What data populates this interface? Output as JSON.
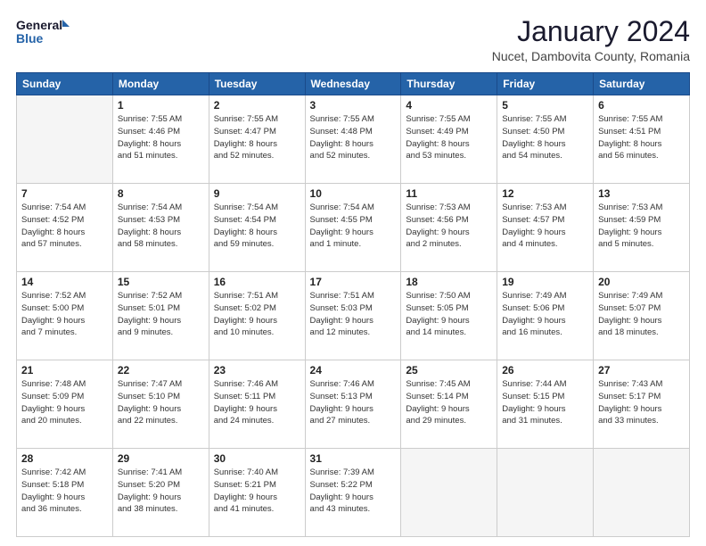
{
  "header": {
    "logo_line1": "General",
    "logo_line2": "Blue",
    "month": "January 2024",
    "location": "Nucet, Dambovita County, Romania"
  },
  "weekdays": [
    "Sunday",
    "Monday",
    "Tuesday",
    "Wednesday",
    "Thursday",
    "Friday",
    "Saturday"
  ],
  "weeks": [
    [
      {
        "day": "",
        "info": ""
      },
      {
        "day": "1",
        "info": "Sunrise: 7:55 AM\nSunset: 4:46 PM\nDaylight: 8 hours\nand 51 minutes."
      },
      {
        "day": "2",
        "info": "Sunrise: 7:55 AM\nSunset: 4:47 PM\nDaylight: 8 hours\nand 52 minutes."
      },
      {
        "day": "3",
        "info": "Sunrise: 7:55 AM\nSunset: 4:48 PM\nDaylight: 8 hours\nand 52 minutes."
      },
      {
        "day": "4",
        "info": "Sunrise: 7:55 AM\nSunset: 4:49 PM\nDaylight: 8 hours\nand 53 minutes."
      },
      {
        "day": "5",
        "info": "Sunrise: 7:55 AM\nSunset: 4:50 PM\nDaylight: 8 hours\nand 54 minutes."
      },
      {
        "day": "6",
        "info": "Sunrise: 7:55 AM\nSunset: 4:51 PM\nDaylight: 8 hours\nand 56 minutes."
      }
    ],
    [
      {
        "day": "7",
        "info": "Sunrise: 7:54 AM\nSunset: 4:52 PM\nDaylight: 8 hours\nand 57 minutes."
      },
      {
        "day": "8",
        "info": "Sunrise: 7:54 AM\nSunset: 4:53 PM\nDaylight: 8 hours\nand 58 minutes."
      },
      {
        "day": "9",
        "info": "Sunrise: 7:54 AM\nSunset: 4:54 PM\nDaylight: 8 hours\nand 59 minutes."
      },
      {
        "day": "10",
        "info": "Sunrise: 7:54 AM\nSunset: 4:55 PM\nDaylight: 9 hours\nand 1 minute."
      },
      {
        "day": "11",
        "info": "Sunrise: 7:53 AM\nSunset: 4:56 PM\nDaylight: 9 hours\nand 2 minutes."
      },
      {
        "day": "12",
        "info": "Sunrise: 7:53 AM\nSunset: 4:57 PM\nDaylight: 9 hours\nand 4 minutes."
      },
      {
        "day": "13",
        "info": "Sunrise: 7:53 AM\nSunset: 4:59 PM\nDaylight: 9 hours\nand 5 minutes."
      }
    ],
    [
      {
        "day": "14",
        "info": "Sunrise: 7:52 AM\nSunset: 5:00 PM\nDaylight: 9 hours\nand 7 minutes."
      },
      {
        "day": "15",
        "info": "Sunrise: 7:52 AM\nSunset: 5:01 PM\nDaylight: 9 hours\nand 9 minutes."
      },
      {
        "day": "16",
        "info": "Sunrise: 7:51 AM\nSunset: 5:02 PM\nDaylight: 9 hours\nand 10 minutes."
      },
      {
        "day": "17",
        "info": "Sunrise: 7:51 AM\nSunset: 5:03 PM\nDaylight: 9 hours\nand 12 minutes."
      },
      {
        "day": "18",
        "info": "Sunrise: 7:50 AM\nSunset: 5:05 PM\nDaylight: 9 hours\nand 14 minutes."
      },
      {
        "day": "19",
        "info": "Sunrise: 7:49 AM\nSunset: 5:06 PM\nDaylight: 9 hours\nand 16 minutes."
      },
      {
        "day": "20",
        "info": "Sunrise: 7:49 AM\nSunset: 5:07 PM\nDaylight: 9 hours\nand 18 minutes."
      }
    ],
    [
      {
        "day": "21",
        "info": "Sunrise: 7:48 AM\nSunset: 5:09 PM\nDaylight: 9 hours\nand 20 minutes."
      },
      {
        "day": "22",
        "info": "Sunrise: 7:47 AM\nSunset: 5:10 PM\nDaylight: 9 hours\nand 22 minutes."
      },
      {
        "day": "23",
        "info": "Sunrise: 7:46 AM\nSunset: 5:11 PM\nDaylight: 9 hours\nand 24 minutes."
      },
      {
        "day": "24",
        "info": "Sunrise: 7:46 AM\nSunset: 5:13 PM\nDaylight: 9 hours\nand 27 minutes."
      },
      {
        "day": "25",
        "info": "Sunrise: 7:45 AM\nSunset: 5:14 PM\nDaylight: 9 hours\nand 29 minutes."
      },
      {
        "day": "26",
        "info": "Sunrise: 7:44 AM\nSunset: 5:15 PM\nDaylight: 9 hours\nand 31 minutes."
      },
      {
        "day": "27",
        "info": "Sunrise: 7:43 AM\nSunset: 5:17 PM\nDaylight: 9 hours\nand 33 minutes."
      }
    ],
    [
      {
        "day": "28",
        "info": "Sunrise: 7:42 AM\nSunset: 5:18 PM\nDaylight: 9 hours\nand 36 minutes."
      },
      {
        "day": "29",
        "info": "Sunrise: 7:41 AM\nSunset: 5:20 PM\nDaylight: 9 hours\nand 38 minutes."
      },
      {
        "day": "30",
        "info": "Sunrise: 7:40 AM\nSunset: 5:21 PM\nDaylight: 9 hours\nand 41 minutes."
      },
      {
        "day": "31",
        "info": "Sunrise: 7:39 AM\nSunset: 5:22 PM\nDaylight: 9 hours\nand 43 minutes."
      },
      {
        "day": "",
        "info": ""
      },
      {
        "day": "",
        "info": ""
      },
      {
        "day": "",
        "info": ""
      }
    ]
  ]
}
